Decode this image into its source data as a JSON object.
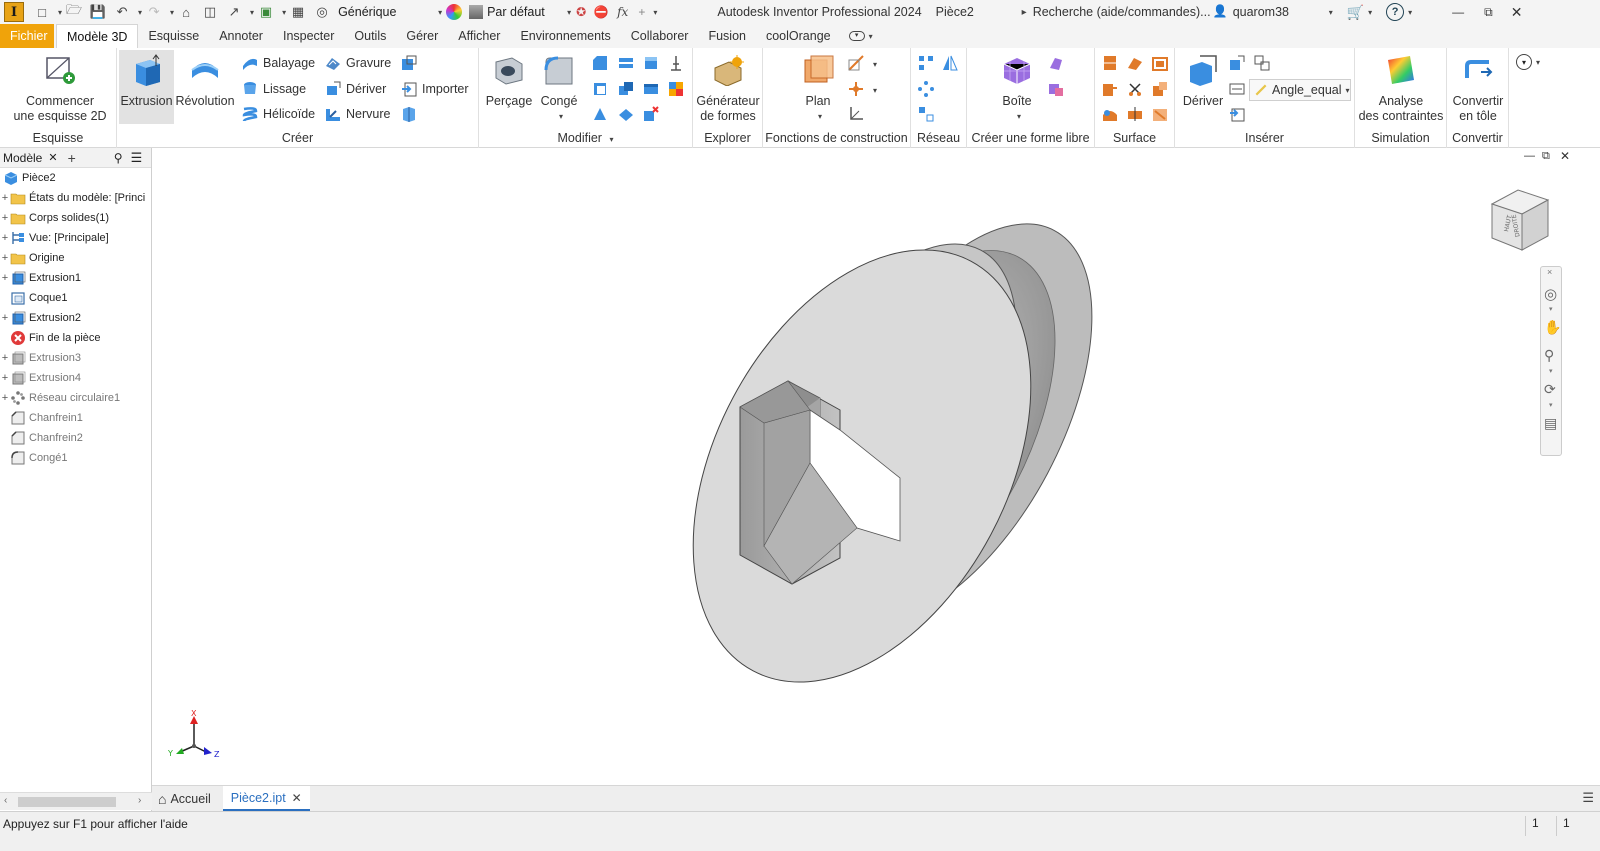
{
  "app": {
    "title": "Autodesk Inventor Professional 2024",
    "document": "Pièce2",
    "logo": "I"
  },
  "quick_access": {
    "appearance": "Générique",
    "material": "Par défaut",
    "search_placeholder": "Recherche (aide/commandes)...",
    "user": "quarom38"
  },
  "tabs": [
    "Fichier",
    "Modèle 3D",
    "Esquisse",
    "Annoter",
    "Inspecter",
    "Outils",
    "Gérer",
    "Afficher",
    "Environnements",
    "Collaborer",
    "Fusion",
    "coolOrange"
  ],
  "ribbon": {
    "esquisse": {
      "panel": "Esquisse",
      "button_line1": "Commencer",
      "button_line2": "une esquisse 2D"
    },
    "creer": {
      "panel": "Créer",
      "extrusion": "Extrusion",
      "revolution": "Révolution",
      "balayage": "Balayage",
      "lissage": "Lissage",
      "helicoide": "Hélicoïde",
      "gravure": "Gravure",
      "deriver": "Dériver",
      "nervure": "Nervure",
      "importer": "Importer"
    },
    "modifier": {
      "panel": "Modifier",
      "percage": "Perçage",
      "conge": "Congé"
    },
    "explorer": {
      "panel": "Explorer",
      "gen_line1": "Générateur",
      "gen_line2": "de formes"
    },
    "fonctions": {
      "panel": "Fonctions de construction",
      "plan": "Plan"
    },
    "reseau": {
      "panel": "Réseau"
    },
    "forme_libre": {
      "panel": "Créer une forme libre",
      "boite": "Boîte"
    },
    "surface": {
      "panel": "Surface"
    },
    "inserer": {
      "panel": "Insérer",
      "deriver": "Dériver",
      "angle": "Angle_equal"
    },
    "simulation": {
      "panel": "Simulation",
      "line1": "Analyse",
      "line2": "des contraintes"
    },
    "convertir": {
      "panel": "Convertir",
      "line1": "Convertir",
      "line2": "en tôle"
    }
  },
  "browser": {
    "tab": "Modèle",
    "root": "Pièce2",
    "items": [
      {
        "label": "États du modèle: [Princi",
        "expand": "+",
        "icon": "folder",
        "dim": false
      },
      {
        "label": "Corps solides(1)",
        "expand": "+",
        "icon": "folder",
        "dim": false
      },
      {
        "label": "Vue: [Principale]",
        "expand": "+",
        "icon": "view",
        "dim": false
      },
      {
        "label": "Origine",
        "expand": "+",
        "icon": "folder",
        "dim": false
      },
      {
        "label": "Extrusion1",
        "expand": "+",
        "icon": "extrude",
        "dim": false
      },
      {
        "label": "Coque1",
        "expand": "",
        "icon": "shell",
        "dim": false
      },
      {
        "label": "Extrusion2",
        "expand": "+",
        "icon": "extrude",
        "dim": false
      },
      {
        "label": "Fin de la pièce",
        "expand": "",
        "icon": "end",
        "dim": false
      },
      {
        "label": "Extrusion3",
        "expand": "+",
        "icon": "extrude-gray",
        "dim": true
      },
      {
        "label": "Extrusion4",
        "expand": "+",
        "icon": "extrude-gray",
        "dim": true
      },
      {
        "label": "Réseau circulaire1",
        "expand": "+",
        "icon": "pattern",
        "dim": true
      },
      {
        "label": "Chanfrein1",
        "expand": "",
        "icon": "chamfer",
        "dim": true
      },
      {
        "label": "Chanfrein2",
        "expand": "",
        "icon": "chamfer",
        "dim": true
      },
      {
        "label": "Congé1",
        "expand": "",
        "icon": "fillet",
        "dim": true
      }
    ]
  },
  "triad": {
    "x": "X",
    "y": "Y",
    "z": "Z"
  },
  "viewcube": {
    "face_top": "HAUT",
    "face_front": "DROITE"
  },
  "doc_tabs": {
    "home": "Accueil",
    "file": "Pièce2.ipt"
  },
  "status": {
    "hint": "Appuyez sur F1 pour afficher l'aide",
    "n1": "1",
    "n2": "1"
  }
}
